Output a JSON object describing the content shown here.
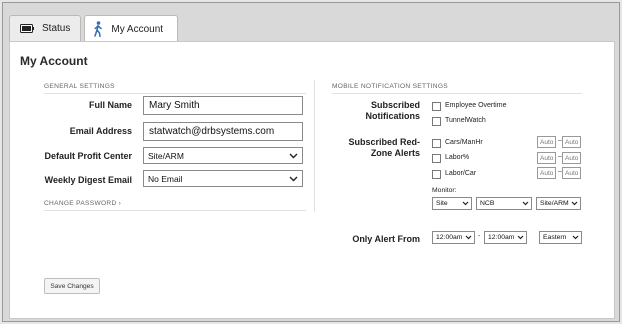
{
  "tabs": [
    {
      "label": "Status",
      "icon": "battery-icon"
    },
    {
      "label": "My Account",
      "icon": "walking-person-icon",
      "active": true
    }
  ],
  "page_title": "My Account",
  "general": {
    "heading": "GENERAL SETTINGS",
    "full_name_label": "Full Name",
    "full_name_value": "Mary Smith",
    "email_label": "Email Address",
    "email_value": "statwatch@drbsystems.com",
    "profit_center_label": "Default Profit Center",
    "profit_center_value": "Site/ARM",
    "digest_label": "Weekly Digest Email",
    "digest_value": "No Email",
    "change_password": "CHANGE PASSWORD ›"
  },
  "mobile": {
    "heading": "MOBILE NOTIFICATION SETTINGS",
    "subscribed_notifications_label": "Subscribed Notifications",
    "notifications": [
      "Employee Overtime",
      "TunnelWatch"
    ],
    "redzone_label": "Subscribed Red-Zone Alerts",
    "redzone_items": [
      {
        "label": "Cars/ManHr",
        "min": "Auto",
        "max": "Auto"
      },
      {
        "label": "Labor%",
        "min": "Auto",
        "max": "Auto"
      },
      {
        "label": "Labor/Car",
        "min": "Auto",
        "max": "Auto"
      }
    ],
    "dash": "–",
    "monitor_label": "Monitor:",
    "monitor_values": [
      "Site",
      "NCB",
      "Site/ARM"
    ],
    "alert_from_label": "Only Alert From",
    "alert_from": "12:00am",
    "alert_to": "12:00am",
    "alert_dash": "-",
    "timezone": "Eastern"
  },
  "save_button": "Save Changes",
  "colors": {
    "panel_bg": "#ffffff",
    "frame_bg": "#d9d9d9",
    "accent_icon": "#2f6fb5"
  }
}
